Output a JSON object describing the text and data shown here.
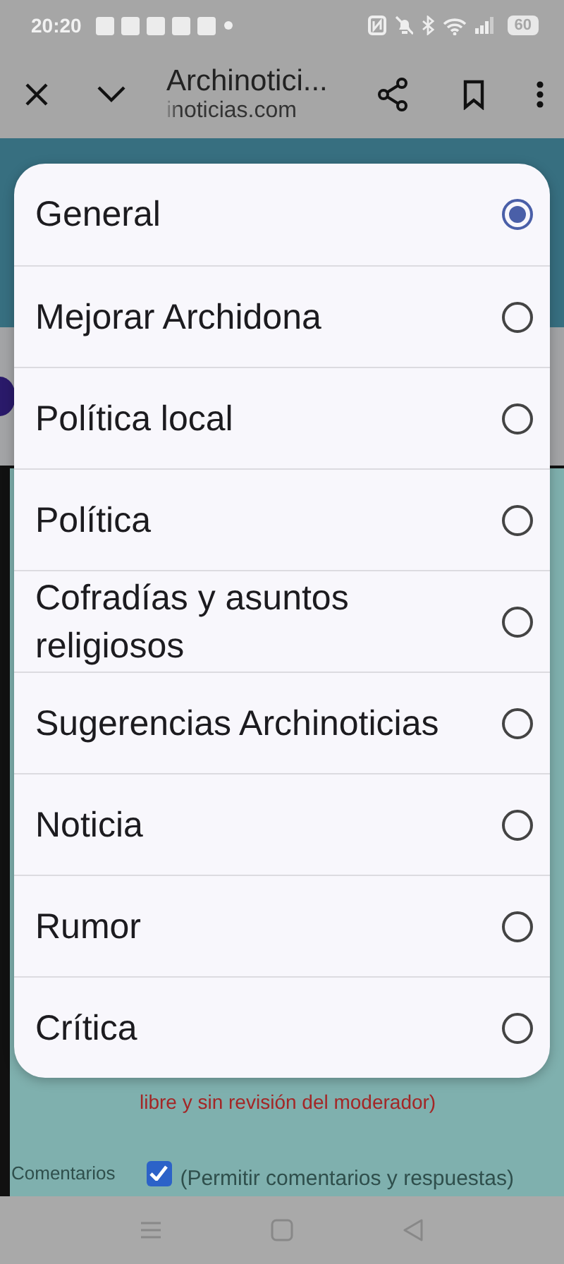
{
  "status_bar": {
    "time": "20:20",
    "battery": "60"
  },
  "browser_toolbar": {
    "title": "Archinotici...",
    "url": "inoticias.com"
  },
  "page": {
    "note": "libre y sin revisión del moderador)",
    "comments": {
      "label": "Comentarios",
      "checked": true,
      "hint": "(Permitir comentarios y respuestas)"
    }
  },
  "dialog": {
    "options": [
      {
        "label": "General",
        "selected": true
      },
      {
        "label": "Mejorar Archidona",
        "selected": false
      },
      {
        "label": "Política local",
        "selected": false
      },
      {
        "label": "Política",
        "selected": false
      },
      {
        "label": "Cofradías y asuntos religiosos",
        "selected": false
      },
      {
        "label": "Sugerencias Archinoticias",
        "selected": false
      },
      {
        "label": "Noticia",
        "selected": false
      },
      {
        "label": "Rumor",
        "selected": false
      },
      {
        "label": "Crítica",
        "selected": false
      }
    ]
  }
}
